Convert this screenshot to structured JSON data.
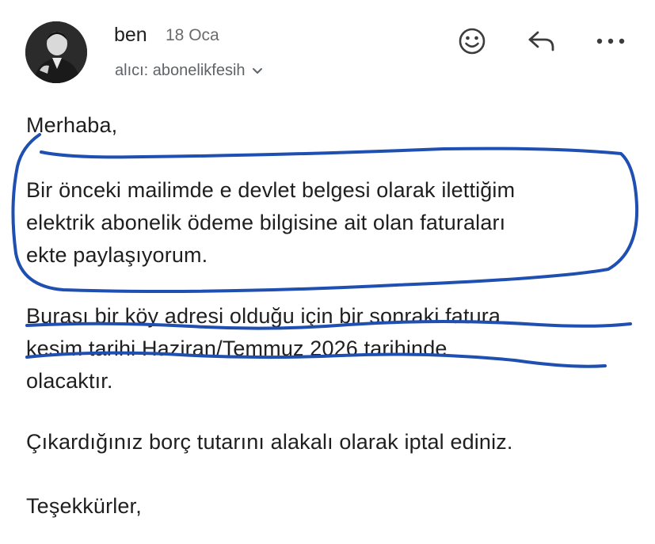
{
  "header": {
    "sender": "ben",
    "date": "18 Oca",
    "recipient": "alıcı: abonelikfesih"
  },
  "icons": {
    "emoji": "emoji-reaction-icon",
    "reply": "reply-icon",
    "more": "more-options-icon",
    "chevron": "chevron-down-icon"
  },
  "message": {
    "greeting": "Merhaba,",
    "p1_line1": "Bir önceki mailimde e devlet belgesi olarak ilettiğim",
    "p1_line2": "elektrik abonelik ödeme bilgisine ait olan faturaları",
    "p1_line3": "ekte paylaşıyorum.",
    "p2_line1": "Burası bir köy adresi olduğu için bir sonraki fatura",
    "p2_line2": "kesim tarihi Haziran/Temmuz 2026 tarihinde",
    "p2_line3": "olacaktır.",
    "p3_line1": "Çıkardığınız borç tutarını alakalı olarak iptal ediniz.",
    "closing": "Teşekkürler,"
  },
  "colors": {
    "text": "#1f1f1f",
    "secondary_text": "#5f6368",
    "annotation_pen": "#1f4fb0"
  }
}
